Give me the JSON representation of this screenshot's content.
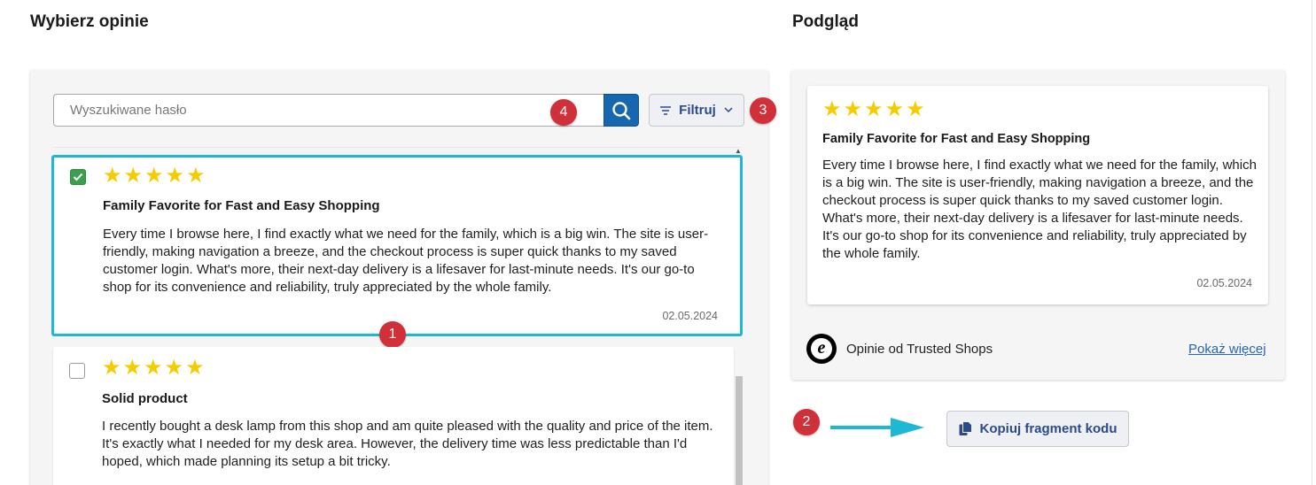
{
  "headings": {
    "select_reviews": "Wybierz opinie",
    "preview": "Podgląd"
  },
  "search": {
    "placeholder": "Wyszukiwane hasło",
    "value": ""
  },
  "filter": {
    "label": "Filtruj"
  },
  "badges": {
    "one": "1",
    "two": "2",
    "three": "3",
    "four": "4"
  },
  "reviews": [
    {
      "checked": true,
      "stars": "★★★★★",
      "rating": 5,
      "title": "Family Favorite for Fast and Easy Shopping",
      "body": "Every time I browse here, I find exactly what we need for the family, which is a big win. The site is user-friendly, making navigation a breeze, and the checkout process is super quick thanks to my saved customer login. What's more, their next-day delivery is a lifesaver for last-minute needs. It's our go-to shop for its convenience and reliability, truly appreciated by the whole family.",
      "date": "02.05.2024"
    },
    {
      "checked": false,
      "stars": "★★★★★",
      "rating": 5,
      "title": "Solid product",
      "body": "I recently bought a desk lamp from this shop and am quite pleased with the quality and price of the item. It's exactly what I needed for my desk area. However, the delivery time was less predictable than I'd hoped, which made planning its setup a bit tricky."
    }
  ],
  "preview": {
    "stars": "★★★★★",
    "rating": 5,
    "title": "Family Favorite for Fast and Easy Shopping",
    "body": "Every time I browse here, I find exactly what we need for the family, which is a big win. The site is user-friendly, making navigation a breeze, and the checkout process is super quick thanks to my saved customer login. What's more, their next-day delivery is a lifesaver for last-minute needs. It's our go-to shop for its convenience and reliability, truly appreciated by the whole family.",
    "date": "02.05.2024",
    "source_label": "Opinie od Trusted Shops",
    "logo_letter": "e",
    "show_more": "Pokaż więcej"
  },
  "copy": {
    "label": "Kopiuj fragment kodu"
  },
  "colors": {
    "accent_blue": "#1667b0",
    "selected_border": "#1eb8d4",
    "checkbox_green": "#3aa04e",
    "star_yellow": "#f5cc00",
    "badge_red": "#d0303a",
    "link_blue": "#2467b4",
    "arrow_cyan": "#1eb8d4"
  },
  "icons": {
    "search": "search-icon",
    "filter": "filter-icon",
    "chevron": "chevron-down-icon",
    "copy": "copy-icon",
    "check": "check-icon",
    "arrow": "arrow-right-icon",
    "logo": "trusted-shops-logo"
  }
}
